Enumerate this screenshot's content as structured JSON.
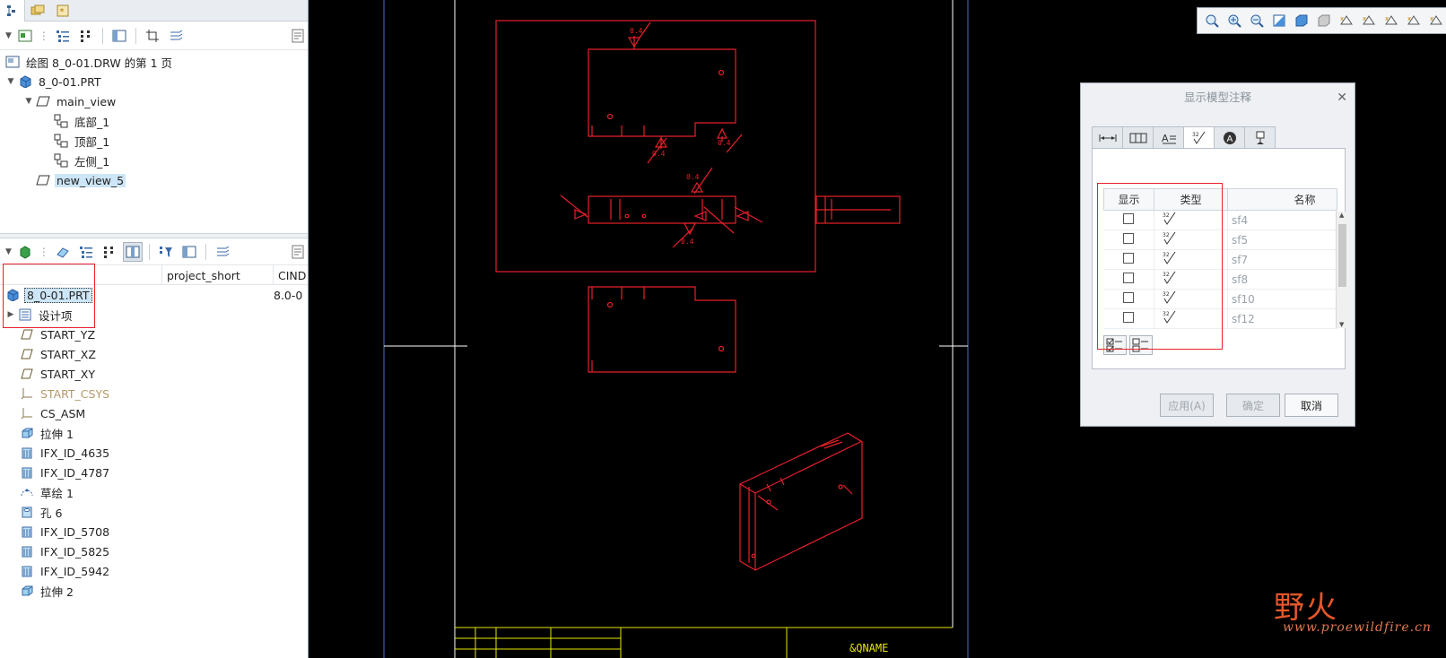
{
  "model_tree": {
    "root": "绘图 8_0-01.DRW 的第 1 页",
    "part": "8_0-01.PRT",
    "main_view": "main_view",
    "views": [
      "底部_1",
      "顶部_1",
      "左侧_1"
    ],
    "new_view": "new_view_5"
  },
  "feature_tree": {
    "columns": [
      "project_short",
      "CIND"
    ],
    "part_row": {
      "name": "8_0-01.PRT",
      "value": "8.0-0"
    },
    "design_items": "设计项",
    "features": [
      {
        "label": "START_YZ",
        "icon": "datum-plane-icon"
      },
      {
        "label": "START_XZ",
        "icon": "datum-plane-icon"
      },
      {
        "label": "START_XY",
        "icon": "datum-plane-icon"
      },
      {
        "label": "START_CSYS",
        "icon": "csys-icon"
      },
      {
        "label": "CS_ASM",
        "icon": "csys-icon"
      },
      {
        "label": "拉伸 1",
        "icon": "extrude-icon"
      },
      {
        "label": "IFX_ID_4635",
        "icon": "ifx-icon"
      },
      {
        "label": "IFX_ID_4787",
        "icon": "ifx-icon"
      },
      {
        "label": "草绘 1",
        "icon": "sketch-icon"
      },
      {
        "label": "孔 6",
        "icon": "hole-icon"
      },
      {
        "label": "IFX_ID_5708",
        "icon": "ifx-icon"
      },
      {
        "label": "IFX_ID_5825",
        "icon": "ifx-icon"
      },
      {
        "label": "IFX_ID_5942",
        "icon": "ifx-icon"
      },
      {
        "label": "拉伸 2",
        "icon": "extrude-icon"
      }
    ]
  },
  "drawing": {
    "roughness_value": "0.4",
    "title_block_name": "&QNAME",
    "line_color": "#e8202a",
    "frame_color": "#ffffff",
    "title_color": "#e6e600"
  },
  "dialog": {
    "title": "显示模型注释",
    "headers": {
      "show": "显示",
      "type": "类型",
      "name": "名称"
    },
    "rows": [
      {
        "name": "sf4",
        "checked": false
      },
      {
        "name": "sf5",
        "checked": false
      },
      {
        "name": "sf7",
        "checked": false
      },
      {
        "name": "sf8",
        "checked": false
      },
      {
        "name": "sf10",
        "checked": false
      },
      {
        "name": "sf12",
        "checked": false
      }
    ],
    "apply": "应用(A)",
    "ok": "确定",
    "cancel": "取消"
  },
  "watermark": {
    "brand": "野火",
    "url": "www.proewildfire.cn"
  }
}
